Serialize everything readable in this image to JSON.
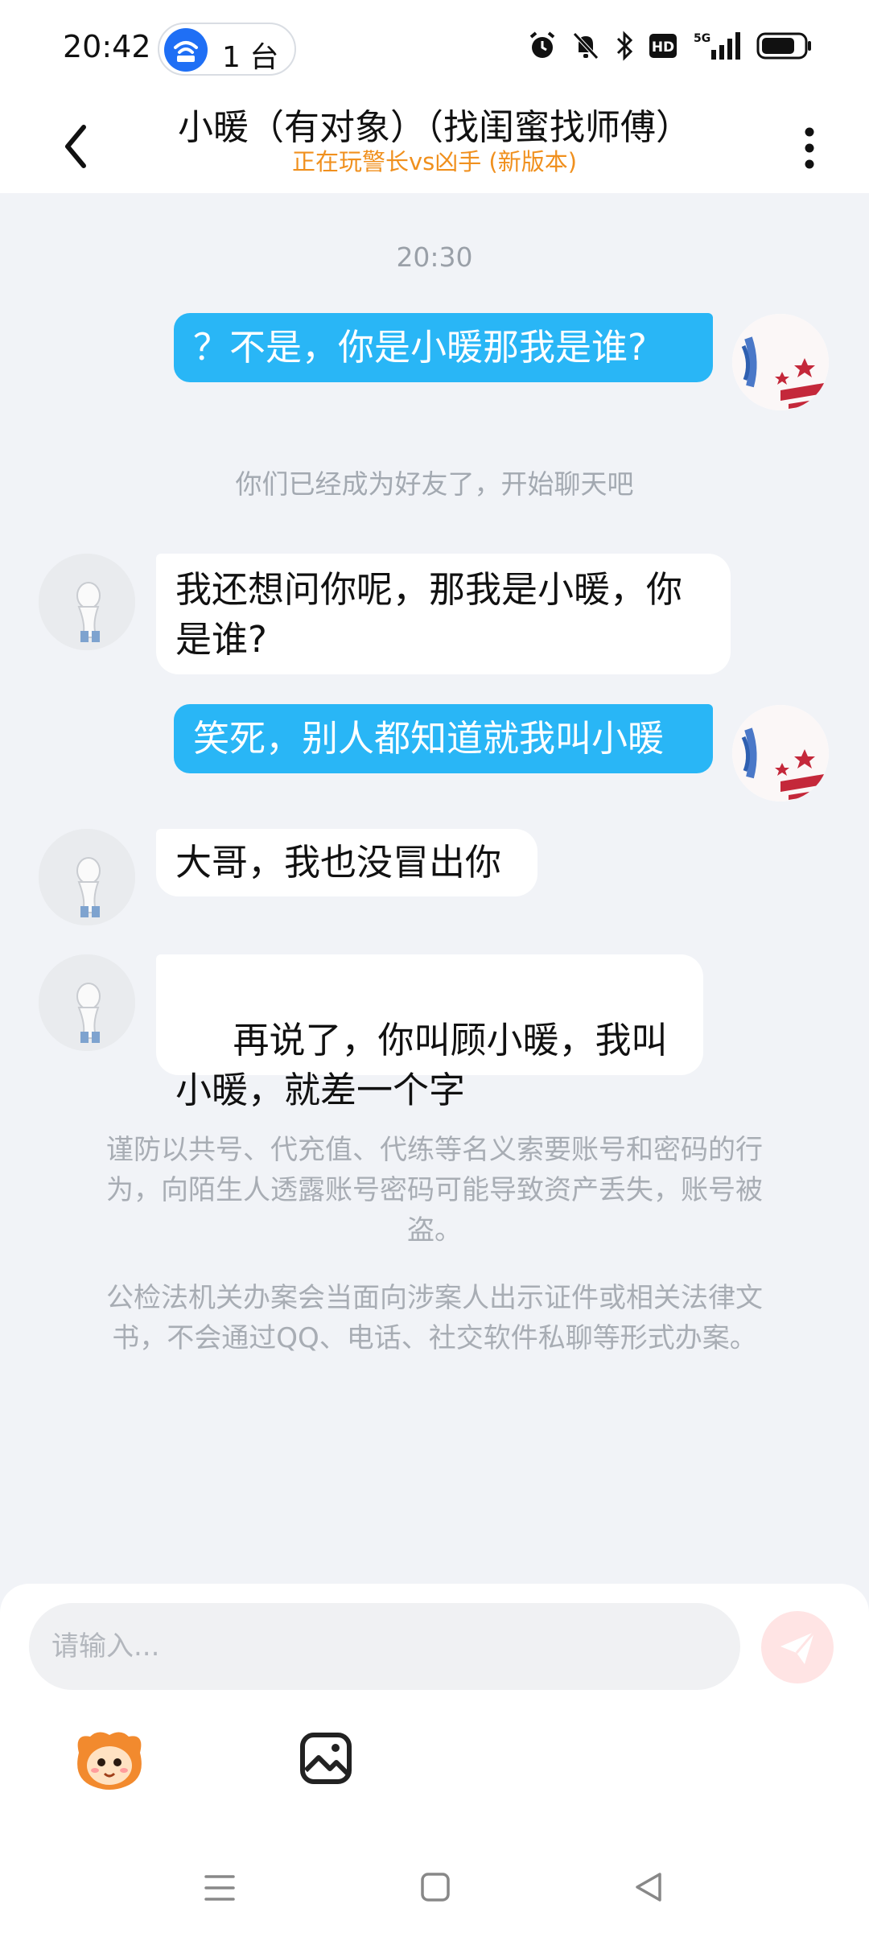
{
  "status_bar": {
    "time": "20:42",
    "hotspot_count": "1 台",
    "icons": [
      "alarm-icon",
      "mute-bell-icon",
      "bluetooth-icon",
      "hd-icon",
      "5g-signal-icon",
      "battery-icon"
    ],
    "hd_label": "HD",
    "network_label": "5G"
  },
  "header": {
    "title": "小暖（有对象）（找闺蜜找师傅）",
    "subtitle": "正在玩警长vs凶手 (新版本)"
  },
  "chat": {
    "timestamp": "20:30",
    "system_message": "你们已经成为好友了，开始聊天吧",
    "messages": [
      {
        "direction": "out",
        "text": "？不是，你是小暖那我是谁?"
      },
      {
        "direction": "in",
        "text": "我还想问你呢，那我是小暖，你是谁?"
      },
      {
        "direction": "out",
        "text": "笑死，别人都知道就我叫小暖"
      },
      {
        "direction": "in",
        "text": "大哥，我也没冒出你"
      },
      {
        "direction": "in",
        "text": " 再说了，你叫顾小暖，我叫小暖，就差一个字"
      }
    ],
    "notices": [
      "谨防以共号、代充值、代练等名义索要账号和密码的行为，向陌生人透露账号密码可能导致资产丢失，账号被盗。",
      "公检法机关办案会当面向涉案人出示证件或相关法律文书，不会通过QQ、电话、社交软件私聊等形式办案。"
    ]
  },
  "input": {
    "placeholder": "请输入..."
  },
  "colors": {
    "outgoing_bubble": "#29b6f6",
    "incoming_bubble": "#ffffff",
    "subtitle": "#f0901e",
    "send_button": "#ffe4e4",
    "background": "#f1f3f7"
  }
}
